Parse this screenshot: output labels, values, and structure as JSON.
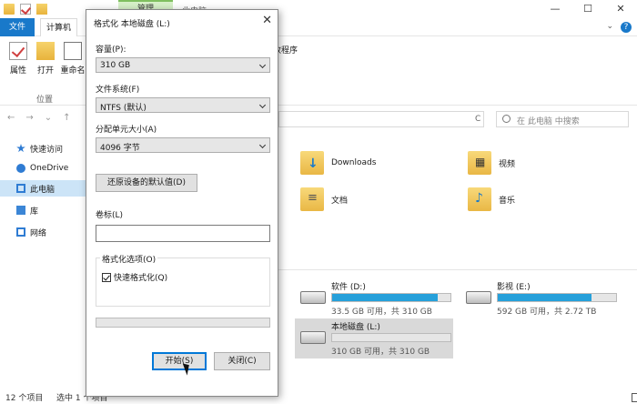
{
  "titlebar": {
    "manage_tab": "管理",
    "title": "此电脑",
    "minimize": "—",
    "maximize": "☐",
    "close": "✕"
  },
  "ribbon": {
    "file_tab": "文件",
    "computer_tab": "计算机",
    "help": "?",
    "buttons": [
      {
        "label": "属性"
      },
      {
        "label": "打开"
      },
      {
        "label": "重命名"
      }
    ],
    "group_label": "位置",
    "program_text": "故程序"
  },
  "addressbar": {
    "right_text": "C",
    "search_placeholder": "在 此电脑 中搜索"
  },
  "navpane": {
    "items": [
      {
        "label": "快速访问"
      },
      {
        "label": "OneDrive"
      },
      {
        "label": "此电脑"
      },
      {
        "label": "库"
      },
      {
        "label": "网络"
      }
    ]
  },
  "folders": [
    {
      "name": "Downloads"
    },
    {
      "name": "视频"
    },
    {
      "name": "文档"
    },
    {
      "name": "音乐"
    }
  ],
  "drives": [
    {
      "name": "软件 (D:)",
      "free": "33.5 GB 可用，共 310 GB",
      "used_fraction": 0.89
    },
    {
      "name": "影视 (E:)",
      "free": "592 GB 可用，共 2.72 TB",
      "used_fraction": 0.79
    },
    {
      "name": "本地磁盘 (L:)",
      "free": "310 GB 可用，共 310 GB",
      "used_fraction": 0.0
    }
  ],
  "statusbar": {
    "count": "12 个项目",
    "selected": "选中 1 个项目"
  },
  "dialog": {
    "title": "格式化 本地磁盘 (L:)",
    "close": "✕",
    "capacity_label": "容量(P):",
    "capacity_value": "310 GB",
    "fs_label": "文件系统(F)",
    "fs_value": "NTFS (默认)",
    "alloc_label": "分配单元大小(A)",
    "alloc_value": "4096 字节",
    "restore_button": "还原设备的默认值(D)",
    "volume_label": "卷标(L)",
    "volume_value": "",
    "options_label": "格式化选项(O)",
    "quick_format": "快速格式化(Q)",
    "progress": 0,
    "start_button": "开始(S)",
    "close_button": "关闭(C)"
  }
}
